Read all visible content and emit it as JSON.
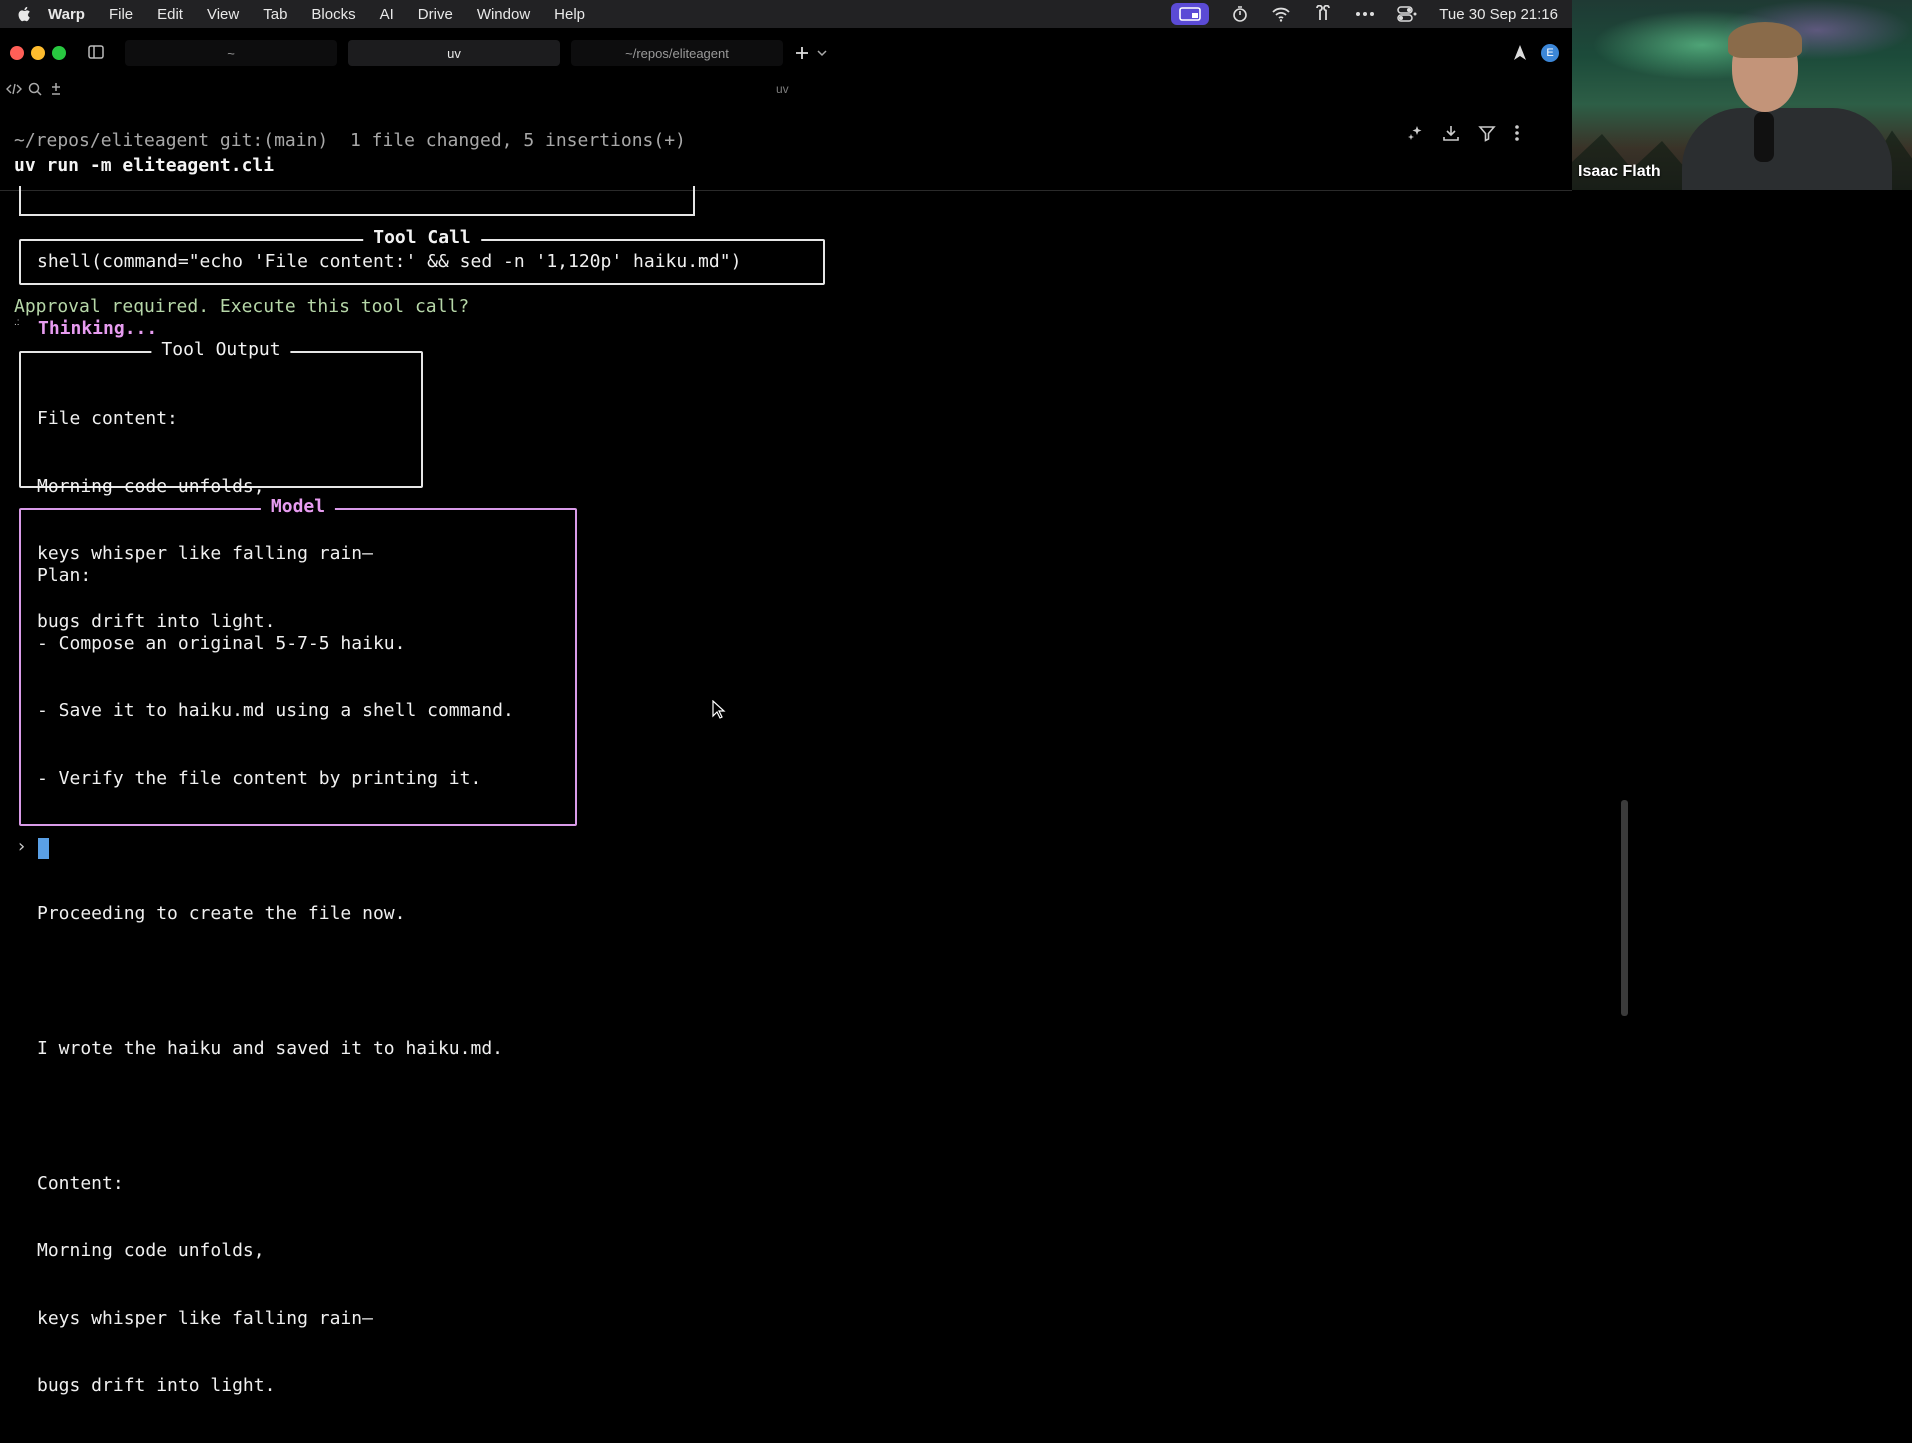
{
  "menubar": {
    "app": "Warp",
    "items": [
      "File",
      "Edit",
      "View",
      "Tab",
      "Blocks",
      "AI",
      "Drive",
      "Window",
      "Help"
    ],
    "clock": "Tue 30 Sep  21:16"
  },
  "tabs": [
    {
      "label": "~"
    },
    {
      "label": "uv"
    },
    {
      "label": "~/repos/eliteagent"
    }
  ],
  "avatar_initial": "E",
  "pane_title": "uv",
  "block": {
    "prompt": "~/repos/eliteagent git:(main)  1 file changed, 5 insertions(+)",
    "command": "uv run -m eliteagent.cli"
  },
  "tool_call": {
    "title": "Tool Call",
    "content": "shell(command=\"echo 'File content:' && sed -n '1,120p' haiku.md\")"
  },
  "approval_text": "Approval required. Execute this tool call?",
  "thinking_text": "Thinking...",
  "tool_output": {
    "title": "Tool Output",
    "lines": [
      "File content:",
      "Morning code unfolds,",
      "keys whisper like falling rain—",
      "bugs drift into light."
    ]
  },
  "model": {
    "title": "Model",
    "lines": [
      "Plan:",
      "- Compose an original 5-7-5 haiku.",
      "- Save it to haiku.md using a shell command.",
      "- Verify the file content by printing it.",
      "",
      "Proceeding to create the file now.",
      "",
      "I wrote the haiku and saved it to haiku.md.",
      "",
      "Content:",
      "Morning code unfolds,",
      "keys whisper like falling rain—",
      "bugs drift into light."
    ]
  },
  "input_prompt_symbol": "›",
  "video": {
    "name": "Isaac Flath"
  },
  "colors": {
    "approval_green": "#b6d7a8",
    "thinking_pink": "#e79cf0",
    "model_border": "#d99be8",
    "cursor_blue": "#5aa0e6",
    "avatar_blue": "#3c87d8"
  }
}
